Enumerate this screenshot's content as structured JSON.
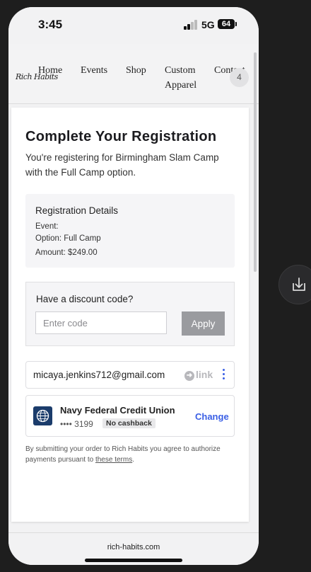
{
  "status_bar": {
    "time": "3:45",
    "network": "5G",
    "battery": "64"
  },
  "header": {
    "logo": "Rich Habits",
    "nav": [
      "Home",
      "Events",
      "Shop",
      "Custom",
      "Apparel",
      "Contact"
    ],
    "cart_count": "4"
  },
  "registration": {
    "title": "Complete Your Registration",
    "intro": "You're registering for Birmingham Slam Camp with the Full Camp option.",
    "details_title": "Registration Details",
    "event_line": "Event:",
    "option_line": "Option: Full Camp",
    "amount_line": "Amount: $249.00"
  },
  "discount": {
    "label": "Have a discount code?",
    "placeholder": "Enter code",
    "apply": "Apply"
  },
  "payment": {
    "email": "micaya.jenkins712@gmail.com",
    "link_text": "link",
    "bank_name": "Navy Federal Credit Union",
    "account_mask": "•••• 3199",
    "cashback": "No cashback",
    "change": "Change"
  },
  "terms": {
    "text": "By submitting your order to Rich Habits you agree to authorize payments pursuant to ",
    "link": "these terms",
    "end": "."
  },
  "browser": {
    "url": "rich-habits.com"
  }
}
